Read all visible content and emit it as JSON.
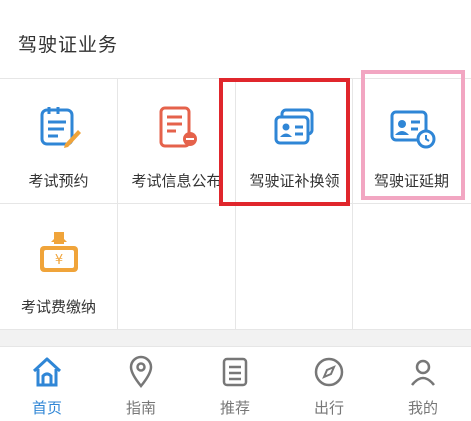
{
  "section": {
    "title": "驾驶证业务"
  },
  "services": [
    {
      "label": "考试预约",
      "icon": "exam-appointment-icon"
    },
    {
      "label": "考试信息公布",
      "icon": "exam-info-icon"
    },
    {
      "label": "驾驶证补换领",
      "icon": "license-replace-icon"
    },
    {
      "label": "驾驶证延期",
      "icon": "license-extend-icon"
    },
    {
      "label": "考试费缴纳",
      "icon": "exam-fee-icon"
    }
  ],
  "tabs": [
    {
      "label": "首页",
      "icon": "home-icon",
      "active": true
    },
    {
      "label": "指南",
      "icon": "location-pin-icon",
      "active": false
    },
    {
      "label": "推荐",
      "icon": "list-icon",
      "active": false
    },
    {
      "label": "出行",
      "icon": "compass-icon",
      "active": false
    },
    {
      "label": "我的",
      "icon": "user-icon",
      "active": false
    }
  ],
  "colors": {
    "accent_blue": "#2f86d6",
    "icon_orange": "#f0a43a",
    "icon_red": "#e5624b",
    "highlight_red": "#e0262c",
    "highlight_pink": "#f2a6c2"
  }
}
